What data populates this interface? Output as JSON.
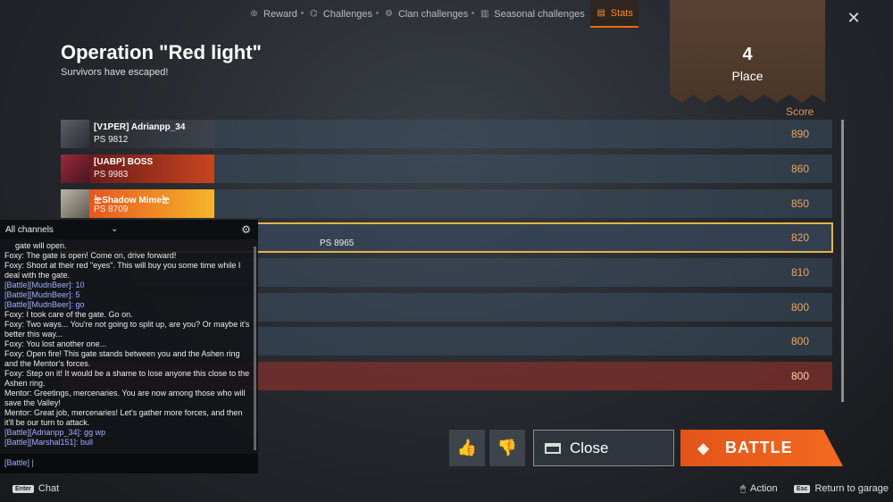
{
  "tabs": [
    {
      "label": "Reward",
      "icon": "reward-icon"
    },
    {
      "label": "Challenges",
      "icon": "challenges-icon"
    },
    {
      "label": "Clan challenges",
      "icon": "clan-challenges-icon"
    },
    {
      "label": "Seasonal challenges",
      "icon": "seasonal-challenges-icon"
    },
    {
      "label": "Stats",
      "icon": "stats-icon",
      "active": true
    }
  ],
  "header": {
    "title": "Operation \"Red light\"",
    "subtitle": "Survivors have escaped!"
  },
  "place": {
    "number": "4",
    "label": "Place"
  },
  "scoreboard": {
    "score_header": "Score",
    "rows": [
      {
        "name": "[V1PER] Adrianpp_34",
        "ps": "PS 9812",
        "score": "890"
      },
      {
        "name": "[UABP] BOSS",
        "ps": "PS 9983",
        "score": "860"
      },
      {
        "name": "눈Shadow Mime눈",
        "ps": "PS 8709",
        "score": "850"
      },
      {
        "name": "",
        "ps": "PS 8965",
        "score": "820",
        "highlight": true
      },
      {
        "name": "",
        "ps": "",
        "score": "810"
      },
      {
        "name": "",
        "ps": "",
        "score": "800"
      },
      {
        "name": "",
        "ps": "",
        "score": "800"
      },
      {
        "name": "",
        "ps": "",
        "score": "800",
        "red": true
      }
    ]
  },
  "chat": {
    "channel": "All channels",
    "messages": [
      {
        "text": "gate will open.",
        "type": "sys"
      },
      {
        "text": "Foxy: The gate is open! Come on, drive forward!",
        "type": "sys"
      },
      {
        "text": "Foxy: Shoot at their red \"eyes\". This will buy you some time while I deal with the gate.",
        "type": "sys"
      },
      {
        "text": "[Battle][MudnBeer]: 10",
        "type": "bt"
      },
      {
        "text": "[Battle][MudnBeer]: 5",
        "type": "bt"
      },
      {
        "text": "[Battle][MudnBeer]: go",
        "type": "bt"
      },
      {
        "text": "Foxy: I took care of the gate. Go on.",
        "type": "sys"
      },
      {
        "text": "Foxy: Two ways... You're not going to split up, are you? Or maybe it's better this way...",
        "type": "sys"
      },
      {
        "text": "Foxy: You lost another one...",
        "type": "sys"
      },
      {
        "text": "Foxy: Open fire! This gate stands between you and the Ashen ring and the Mentor's forces.",
        "type": "sys"
      },
      {
        "text": "Foxy: Step on it! It would be a shame to lose anyone this close to the Ashen ring.",
        "type": "sys"
      },
      {
        "text": "Mentor: Greetings, mercenaries. You are now among those who will save the Valley!",
        "type": "sys"
      },
      {
        "text": "Mentor: Great job, mercenaries! Let's gather more forces, and then it'll be our turn to attack.",
        "type": "sys"
      },
      {
        "text": "[Battle][Adrianpp_34]: gg wp",
        "type": "bt"
      },
      {
        "text": "[Battle][Marshal151]: bull",
        "type": "bt"
      }
    ],
    "input_prefix": "[Battle]"
  },
  "actions": {
    "close_label": "Close",
    "battle_label": "BATTLE"
  },
  "footer": {
    "chat_key": "Enter",
    "chat_label": "Chat",
    "action_label": "Action",
    "return_key": "Esc",
    "return_label": "Return to garage"
  }
}
